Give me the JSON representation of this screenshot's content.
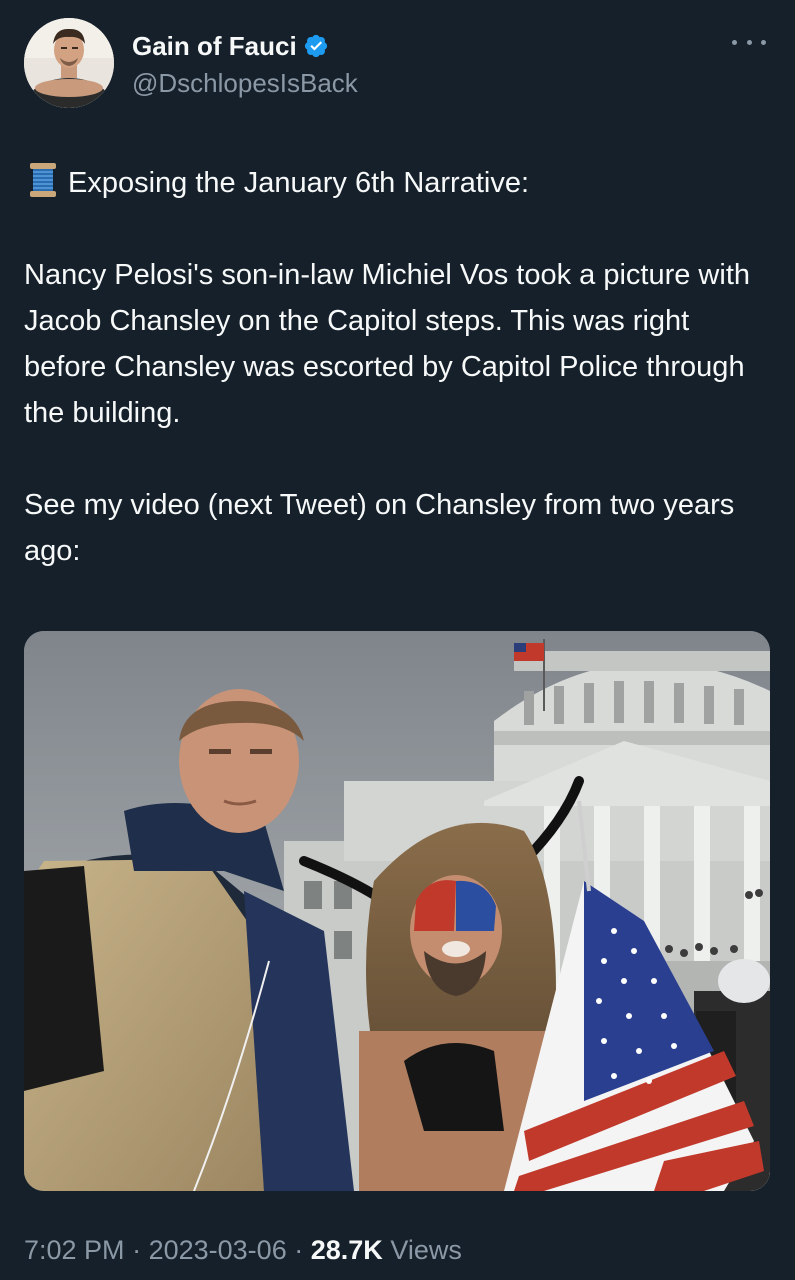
{
  "author": {
    "display_name": "Gain of Fauci",
    "handle": "@DschlopesIsBack",
    "verified_icon": "verified-badge-icon",
    "avatar_icon": "profile-avatar"
  },
  "tweet": {
    "thread_emoji": "spool-of-thread-emoji",
    "headline": "Exposing the January 6th Narrative:",
    "paragraph_1": "Nancy Pelosi's son-in-law Michiel Vos took a picture with Jacob Chansley on the Capitol steps.  This was right before Chansley was escorted by Capitol Police through the building.",
    "paragraph_2": "See my video (next Tweet) on Chansley from two years ago:"
  },
  "meta": {
    "time": "7:02 PM",
    "separator": "·",
    "date": "2023-03-06",
    "views_count": "28.7K",
    "views_label": "Views"
  },
  "colors": {
    "background": "#15202b",
    "primary_text": "#f7f9f9",
    "secondary_text": "#8b98a5",
    "verified_blue": "#1d9bf0"
  }
}
